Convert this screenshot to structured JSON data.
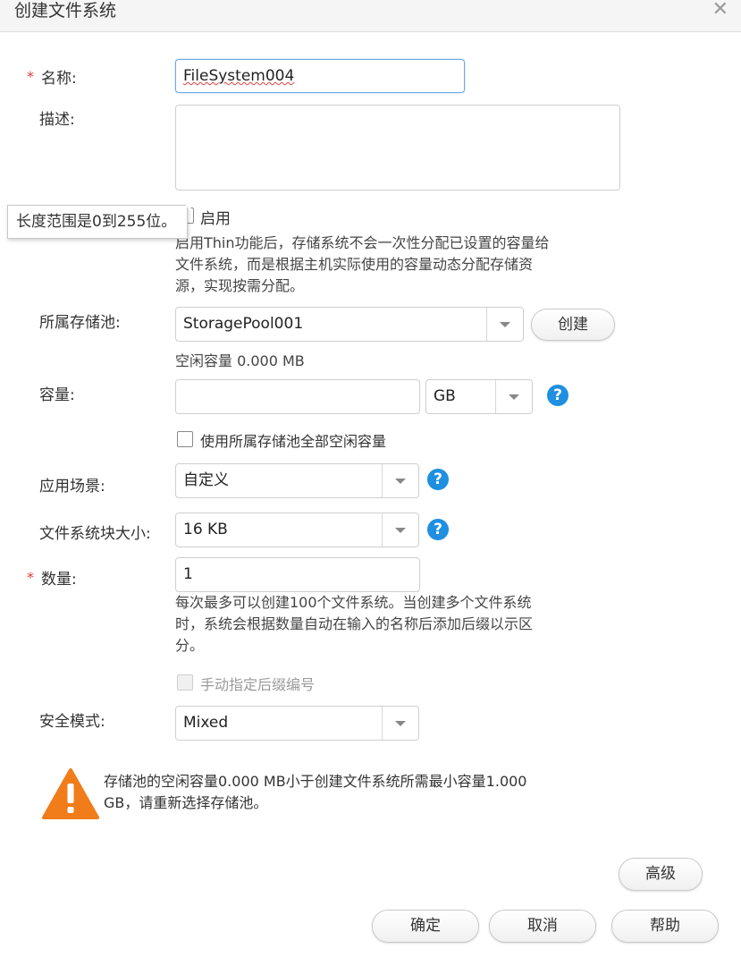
{
  "dialog": {
    "title": "创建文件系统"
  },
  "form": {
    "name": {
      "label": "名称:",
      "value": "FileSystem004"
    },
    "description": {
      "label": "描述:",
      "value": ""
    },
    "tooltip": "长度范围是0到255位。",
    "thin": {
      "label": "启用",
      "hint": [
        "启用Thin功能后，存储系统不会一次性分配已设置的容量给",
        "文件系统，而是根据主机实际使用的容量动态分配存储资",
        "源，实现按需分配。"
      ]
    },
    "pool": {
      "label": "所属存储池:",
      "value": "StoragePool001",
      "create_button": "创建",
      "free_text": "空闲容量 0.000 MB"
    },
    "capacity": {
      "label": "容量:",
      "value": "",
      "unit": "GB",
      "use_all_label": "使用所属存储池全部空闲容量"
    },
    "scenario": {
      "label": "应用场景:",
      "value": "自定义"
    },
    "block_size": {
      "label": "文件系统块大小:",
      "value": "16 KB"
    },
    "quantity": {
      "label": "数量:",
      "value": "1",
      "hint": [
        "每次最多可以创建100个文件系统。当创建多个文件系统",
        "时，系统会根据数量自动在输入的名称后添加后缀以示区",
        "分。"
      ],
      "manual_suffix_label": "手动指定后缀编号"
    },
    "security": {
      "label": "安全模式:",
      "value": "Mixed"
    }
  },
  "warning": {
    "lines": [
      "存储池的空闲容量0.000 MB小于创建文件系统所需最小容量1.000",
      "GB，请重新选择存储池。"
    ]
  },
  "buttons": {
    "advanced": "高级",
    "ok": "确定",
    "cancel": "取消",
    "help": "帮助"
  },
  "colors": {
    "accent": "#1e8fe1",
    "warning": "#f07d1a",
    "required": "#e03c3c"
  }
}
